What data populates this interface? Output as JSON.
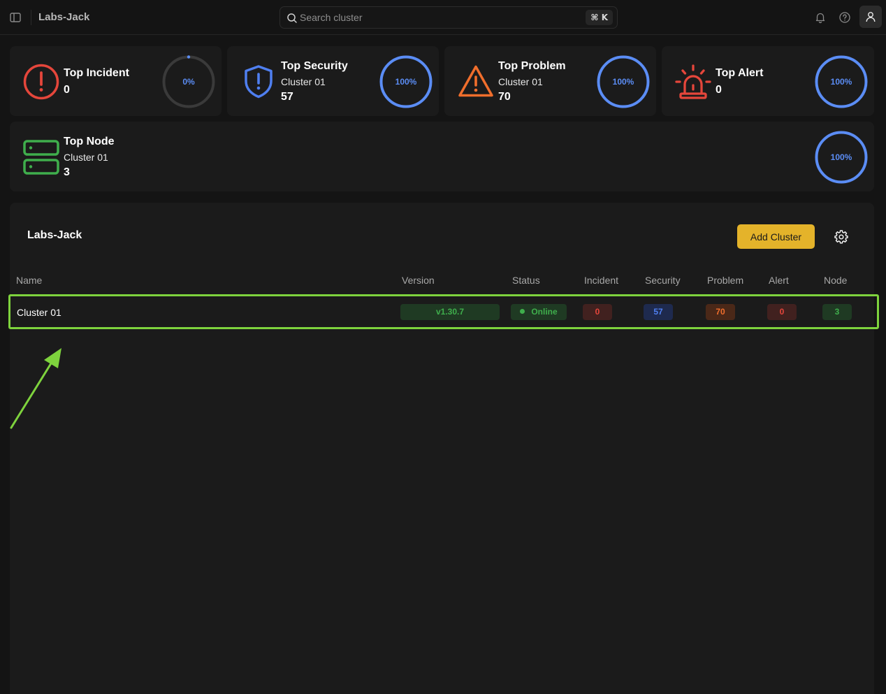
{
  "app": {
    "name": "Labs-Jack"
  },
  "search": {
    "placeholder": "Search cluster",
    "shortcut": "⌘ K"
  },
  "cards": {
    "incident": {
      "title": "Top Incident",
      "count": "0",
      "percent": "0%",
      "progress": 0,
      "color": "#e5463b"
    },
    "security": {
      "title": "Top Security",
      "cluster": "Cluster 01",
      "count": "57",
      "percent": "100%",
      "progress": 1,
      "color": "#4f7ff0"
    },
    "problem": {
      "title": "Top Problem",
      "cluster": "Cluster 01",
      "count": "70",
      "percent": "100%",
      "progress": 1,
      "color": "#f06e2c"
    },
    "alert": {
      "title": "Top Alert",
      "count": "0",
      "percent": "100%",
      "progress": 1,
      "color": "#e5463b"
    },
    "node": {
      "title": "Top Node",
      "cluster": "Cluster 01",
      "count": "3",
      "percent": "100%",
      "progress": 1,
      "color": "#3fae4c"
    }
  },
  "panel": {
    "title": "Labs-Jack",
    "add_button": "Add Cluster",
    "columns": {
      "name": "Name",
      "version": "Version",
      "status": "Status",
      "incident": "Incident",
      "security": "Security",
      "problem": "Problem",
      "alert": "Alert",
      "node": "Node"
    },
    "rows": [
      {
        "name": "Cluster 01",
        "version": "v1.30.7",
        "status": "Online",
        "incident": "0",
        "security": "57",
        "problem": "70",
        "alert": "0",
        "node": "3"
      }
    ]
  },
  "colors": {
    "accent": "#e4b32a",
    "ring": "#4f7ff0",
    "highlight": "#7ed33d"
  }
}
